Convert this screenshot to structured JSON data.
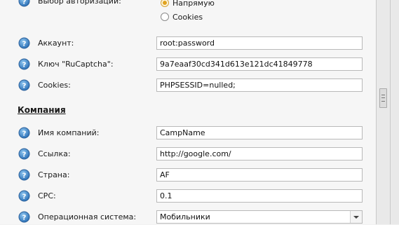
{
  "auth": {
    "label": "Выбор авторизации:",
    "options": [
      "Напрямую",
      "Cookies"
    ],
    "selected": "Напрямую"
  },
  "fields_top": [
    {
      "key": "account",
      "label": "Аккаунт:",
      "value": "root:password"
    },
    {
      "key": "ruc_key",
      "label": "Ключ \"RuCaptcha\":",
      "value": "9a7eaaf30cd341d613e121dc41849778"
    },
    {
      "key": "cookies",
      "label": "Cookies:",
      "value": "PHPSESSID=nulled;"
    }
  ],
  "section_company": "Компания",
  "fields_company": [
    {
      "key": "company_name",
      "label": "Имя компаний:",
      "value": "CampName"
    },
    {
      "key": "link",
      "label": "Ссылка:",
      "value": "http://google.com/"
    },
    {
      "key": "country",
      "label": "Страна:",
      "value": "AF"
    },
    {
      "key": "cpc",
      "label": "CPC:",
      "value": "0.1"
    },
    {
      "key": "os",
      "label": "Операционная система:",
      "value": "Мобильники"
    }
  ],
  "colors": {
    "help_icon": "#3a86c8",
    "radio_selected": "#e0a21f"
  },
  "icons": {
    "help": "question-circle-icon",
    "dropdown": "chevron-down-icon"
  }
}
